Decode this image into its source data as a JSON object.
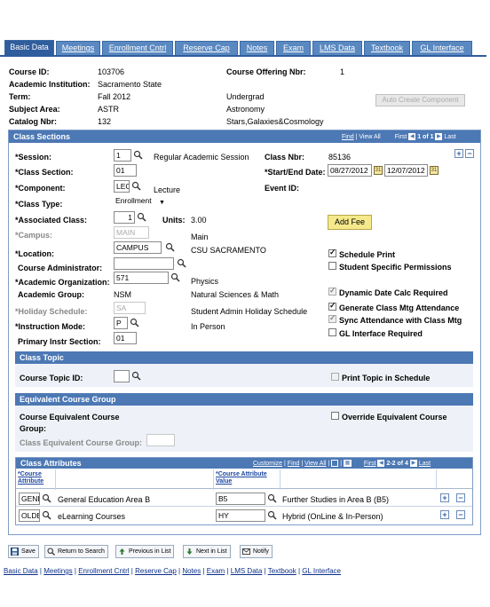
{
  "tabs": [
    {
      "label": "Basic Data",
      "active": true
    },
    {
      "label": "Meetings",
      "active": false
    },
    {
      "label": "Enrollment Cntrl",
      "active": false
    },
    {
      "label": "Reserve Cap",
      "active": false
    },
    {
      "label": "Notes",
      "active": false
    },
    {
      "label": "Exam",
      "active": false
    },
    {
      "label": "LMS Data",
      "active": false
    },
    {
      "label": "Textbook",
      "active": false
    },
    {
      "label": "GL Interface",
      "active": false
    }
  ],
  "header": {
    "course_id_label": "Course ID:",
    "course_id": "103706",
    "course_offering_label": "Course Offering Nbr:",
    "course_offering": "1",
    "institution_label": "Academic Institution:",
    "institution": "Sacramento State",
    "term_label": "Term:",
    "term": "Fall 2012",
    "career": "Undergrad",
    "subject_label": "Subject Area:",
    "subject": "ASTR",
    "subject_desc": "Astronomy",
    "catalog_label": "Catalog Nbr:",
    "catalog": "132",
    "catalog_desc": "Stars,Galaxies&Cosmology",
    "auto_create_button": "Auto Create Component"
  },
  "class_sections": {
    "title": "Class Sections",
    "nav_find": "Find",
    "nav_view_all": "View All",
    "nav_first": "First",
    "nav_count": "1 of 1",
    "nav_last": "Last",
    "session_label": "*Session:",
    "session_value": "1",
    "session_desc": "Regular Academic Session",
    "class_nbr_label": "Class Nbr:",
    "class_nbr": "85136",
    "class_section_label": "*Class Section:",
    "class_section_value": "01",
    "start_end_label": "*Start/End Date:",
    "start_date": "08/27/2012",
    "end_date": "12/07/2012",
    "component_label": "*Component:",
    "component_value": "LEC",
    "component_desc": "Lecture",
    "event_id_label": "Event ID:",
    "class_type_label": "*Class Type:",
    "class_type_value": "Enrollment",
    "associated_class_label": "*Associated Class:",
    "associated_class_value": "1",
    "units_label": "Units:",
    "units_value": "3.00",
    "add_fee_button": "Add Fee",
    "campus_label": "*Campus:",
    "campus_value": "MAIN",
    "campus_desc": "Main",
    "location_label": "*Location:",
    "location_value": "CAMPUS",
    "location_desc": "CSU SACRAMENTO",
    "course_admin_label": "Course Administrator:",
    "academic_org_label": "*Academic Organization:",
    "academic_org_value": "571",
    "academic_org_desc": "Physics",
    "academic_group_label": "Academic Group:",
    "academic_group_value": "NSM",
    "academic_group_desc": "Natural Sciences & Math",
    "holiday_label": "*Holiday Schedule:",
    "holiday_value": "SA",
    "holiday_desc": "Student Admin Holiday Schedule",
    "instruction_mode_label": "*Instruction Mode:",
    "instruction_mode_value": "P",
    "instruction_mode_desc": "In Person",
    "primary_instr_label": "Primary Instr Section:",
    "primary_instr_value": "01",
    "schedule_print_label": "Schedule Print",
    "student_specific_label": "Student Specific Permissions",
    "dynamic_date_label": "Dynamic Date Calc Required",
    "generate_class_label": "Generate Class Mtg Attendance",
    "sync_attendance_label": "Sync Attendance with Class Mtg",
    "gl_interface_label": "GL Interface Required"
  },
  "class_topic": {
    "title": "Class Topic",
    "course_topic_label": "Course Topic ID:",
    "print_topic_label": "Print Topic in Schedule"
  },
  "equivalent": {
    "title": "Equivalent Course Group",
    "course_equiv_label_1": "Course Equivalent Course",
    "course_equiv_label_2": "Group:",
    "class_equiv_label": "Class Equivalent Course Group:",
    "override_label": "Override Equivalent Course"
  },
  "attributes": {
    "title": "Class Attributes",
    "nav_customize": "Customize",
    "nav_find": "Find",
    "nav_view_all": "View All",
    "nav_first": "First",
    "nav_count": "2-2 of 4",
    "nav_last": "Last",
    "col1_line1": "*Course",
    "col1_line2": "Attribute",
    "col2_line1": "*Course Attribute",
    "col2_line2": "Value",
    "rows": [
      {
        "attr": "GENB",
        "attr_desc": "General Education Area B",
        "value": "B5",
        "value_desc": "Further Studies in Area B (B5)"
      },
      {
        "attr": "OLDE",
        "attr_desc": "eLearning Courses",
        "value": "HY",
        "value_desc": "Hybrid (OnLine & In-Person)"
      }
    ]
  },
  "toolbar": {
    "save": "Save",
    "return": "Return to Search",
    "previous": "Previous in List",
    "next": "Next in List",
    "notify": "Notify"
  },
  "footer_links": [
    "Basic Data",
    "Meetings",
    "Enrollment Cntrl",
    "Reserve Cap",
    "Notes",
    "Exam",
    "LMS Data",
    "Textbook",
    "GL Interface"
  ],
  "colors": {
    "accent": "#4c78b4",
    "tab": "#5a88c0",
    "tab_active": "#2f5d9d",
    "section_bg": "#eef2f8",
    "button": "#f5e98c"
  }
}
